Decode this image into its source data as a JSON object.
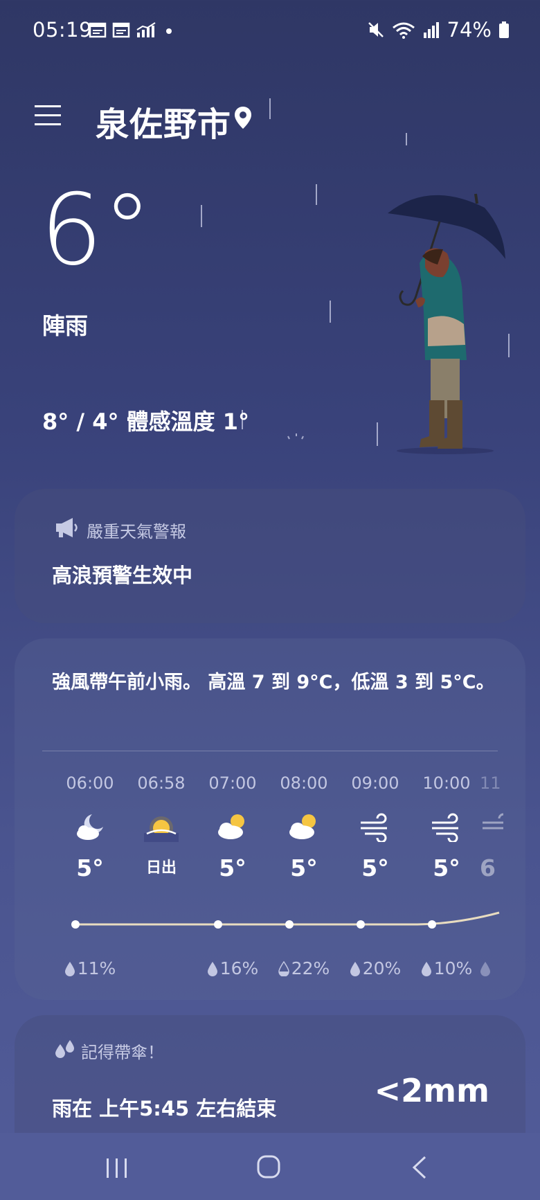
{
  "status_bar": {
    "time": "05:19",
    "battery": "74%"
  },
  "header": {
    "city": "泉佐野市"
  },
  "current": {
    "temperature": "6°",
    "condition": "陣雨",
    "high_low_feels": "8° / 4° 體感溫度 1°"
  },
  "alert": {
    "title": "嚴重天氣警報",
    "body": "高浪預警生效中"
  },
  "forecast": {
    "summary": "強風帶午前小雨。 高溫 7 到 9°C，低溫 3 到 5°C。",
    "hours": [
      {
        "time": "06:00",
        "icon": "night-partly-cloudy-icon",
        "temp": "5°",
        "precip": "11%"
      },
      {
        "time": "06:58",
        "icon": "sunrise-icon",
        "temp": "日出",
        "precip": ""
      },
      {
        "time": "07:00",
        "icon": "partly-cloudy-icon",
        "temp": "5°",
        "precip": "16%"
      },
      {
        "time": "08:00",
        "icon": "partly-cloudy-icon",
        "temp": "5°",
        "precip": "22%"
      },
      {
        "time": "09:00",
        "icon": "wind-icon",
        "temp": "5°",
        "precip": "20%"
      },
      {
        "time": "10:00",
        "icon": "wind-icon",
        "temp": "5°",
        "precip": "10%"
      },
      {
        "time": "11",
        "icon": "wind-icon",
        "temp": "6",
        "precip": ""
      }
    ]
  },
  "rain": {
    "title": "記得帶傘！",
    "body": "雨在 上午5:45 左右結束",
    "amount": "<2mm"
  },
  "colors": {
    "background_top": "#2f3765",
    "background_bottom": "#525c99",
    "temp_line": "#e8dcc0",
    "sun": "#f5c542"
  }
}
